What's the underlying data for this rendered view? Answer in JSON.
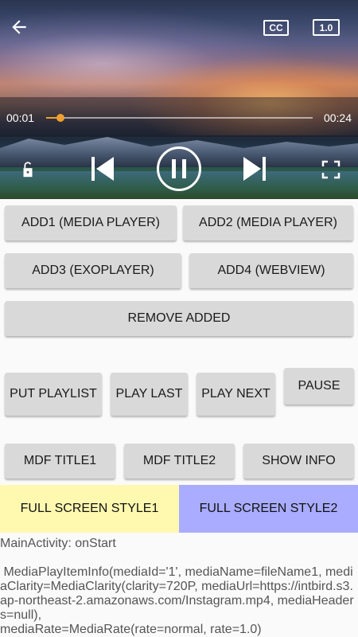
{
  "player": {
    "time_current": "00:01",
    "time_total": "00:24",
    "progress": 0.055,
    "cc_label": "CC",
    "speed_label": "1.0",
    "icons": [
      "back-arrow-icon",
      "cc-icon",
      "playback-speed-icon",
      "lock-open-icon",
      "skip-previous-icon",
      "pause-icon",
      "skip-next-icon",
      "fullscreen-icon"
    ]
  },
  "buttons": {
    "add1": "ADD1 (MEDIA PLAYER)",
    "add2": "ADD2 (MEDIA PLAYER)",
    "add3": "ADD3 (EXOPLAYER)",
    "add4": "ADD4 (WEBVIEW)",
    "remove_added": "REMOVE ADDED",
    "put_playlist": "PUT PLAYLIST",
    "play_last": "PLAY LAST",
    "play_next": "PLAY NEXT",
    "pause": "PAUSE",
    "mdf_title1": "MDF TITLE1",
    "mdf_title2": "MDF TITLE2",
    "show_info": "SHOW INFO",
    "full_screen_style1": "FULL SCREEN STYLE1",
    "full_screen_style2": "FULL SCREEN STYLE2"
  },
  "colors": {
    "style1_bg": "#fff9b0",
    "style2_bg": "#a9acff",
    "seek_accent": "#f0a030"
  },
  "log": {
    "line1": "MainActivity: onStart",
    "line2": " MediaPlayItemInfo(mediaId='1', mediaName=fileName1, mediaClarity=MediaClarity(clarity=720P, mediaUrl=https://intbird.s3.ap-northeast-2.amazonaws.com/Instagram.mp4, mediaHeaders=null),",
    "line3": "mediaRate=MediaRate(rate=normal, rate=1.0)"
  }
}
